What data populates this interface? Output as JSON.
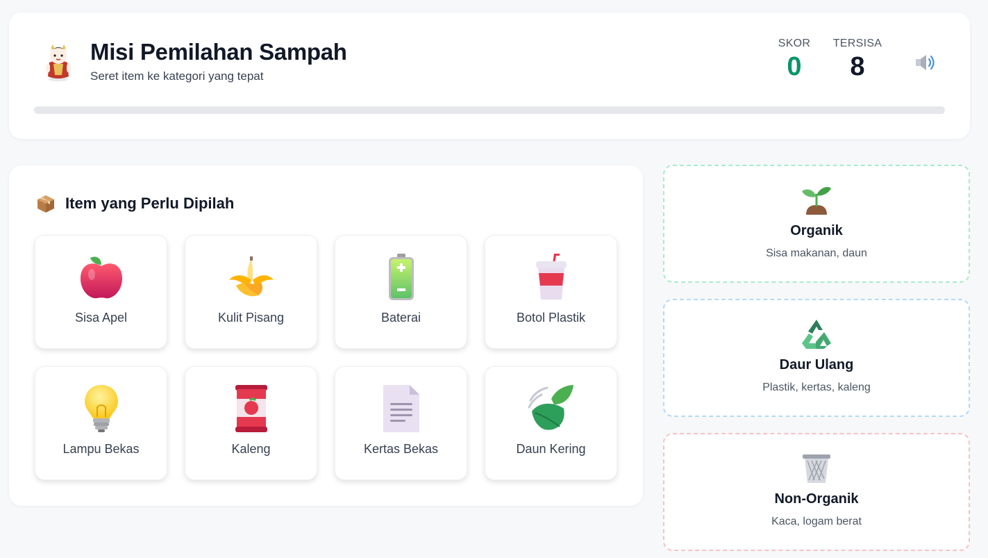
{
  "header": {
    "title": "Misi Pemilahan Sampah",
    "subtitle": "Seret item ke kategori yang tepat",
    "score_label": "SKOR",
    "score_value": "0",
    "remaining_label": "TERSISA",
    "remaining_value": "8",
    "progress_fraction": 0,
    "mascot_icon": "mascot-character-icon",
    "sound_icon": "speaker-icon"
  },
  "items_panel": {
    "title": "Item yang Perlu Dipilah",
    "title_icon": "package-box-icon",
    "items": [
      {
        "label": "Sisa Apel",
        "icon": "apple-icon"
      },
      {
        "label": "Kulit Pisang",
        "icon": "banana-icon"
      },
      {
        "label": "Baterai",
        "icon": "battery-icon"
      },
      {
        "label": "Botol Plastik",
        "icon": "cup-with-straw-icon"
      },
      {
        "label": "Lampu Bekas",
        "icon": "light-bulb-icon"
      },
      {
        "label": "Kaleng",
        "icon": "can-icon"
      },
      {
        "label": "Kertas Bekas",
        "icon": "document-icon"
      },
      {
        "label": "Daun Kering",
        "icon": "leaf-icon"
      }
    ]
  },
  "categories": [
    {
      "title": "Organik",
      "desc": "Sisa makanan, daun",
      "icon": "seedling-icon",
      "border": "#a7ecc8"
    },
    {
      "title": "Daur Ulang",
      "desc": "Plastik, kertas, kaleng",
      "icon": "recycle-icon",
      "border": "#b4d9f6"
    },
    {
      "title": "Non-Organik",
      "desc": "Kaca, logam berat",
      "icon": "wastebasket-icon",
      "border": "#f8c2c2"
    }
  ],
  "colors": {
    "score": "#059669",
    "progress_track": "#e5e7eb",
    "background": "#f7f8fa"
  }
}
